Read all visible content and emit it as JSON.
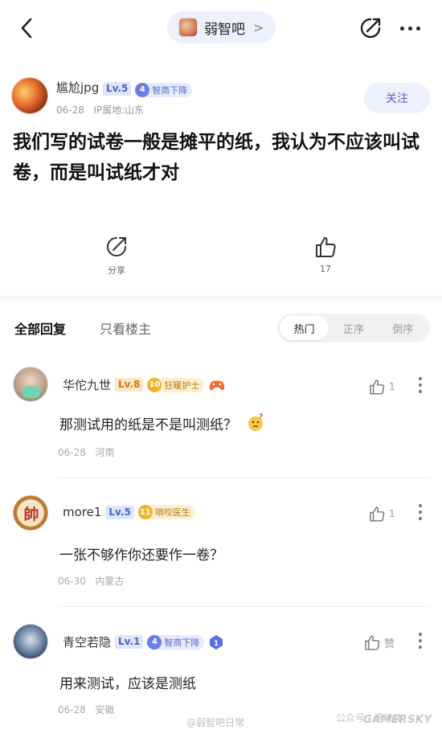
{
  "header": {
    "forum_name": "弱智吧",
    "chevron": ">"
  },
  "post": {
    "author": {
      "name": "尴尬jpg",
      "level": "Lv.5",
      "badge_num": "4",
      "badge_text": "智商下降",
      "date": "06-28",
      "location": "IP属地:山东"
    },
    "follow_label": "关注",
    "title": "我们写的试卷一般是摊平的纸，我认为不应该叫试卷，而是叫试纸才对",
    "share_label": "分享",
    "like_count": "17"
  },
  "reply_tabs": {
    "all": "全部回复",
    "op_only": "只看楼主",
    "sort": [
      "热门",
      "正序",
      "倒序"
    ],
    "active_sort": "热门"
  },
  "comments": [
    {
      "name": "华佗九世",
      "level": "Lv.8",
      "badge_num": "10",
      "badge_text": "狂暖护士",
      "text": "那测试用的纸是不是叫测纸？",
      "date": "06-28",
      "location": "河南",
      "likes": "1"
    },
    {
      "name": "more1",
      "level": "Lv.5",
      "badge_num": "11",
      "badge_text": "啃咬医生",
      "text": "一张不够作你还要作一卷？",
      "date": "06-30",
      "location": "内蒙古",
      "likes": "1"
    },
    {
      "name": "青空若隐",
      "level": "Lv.1",
      "badge_num": "4",
      "badge_text": "智商下降",
      "text": "用来测试，应该是测纸",
      "date": "06-28",
      "location": "安徽",
      "likes": "赞"
    }
  ],
  "watermarks": {
    "weibo": "@弱智吧日常",
    "wechat": "公众号 · 语录体",
    "site": "GAMERSKY"
  },
  "colors": {
    "accent": "#5463c9",
    "pill_bg": "#eef0fb"
  }
}
